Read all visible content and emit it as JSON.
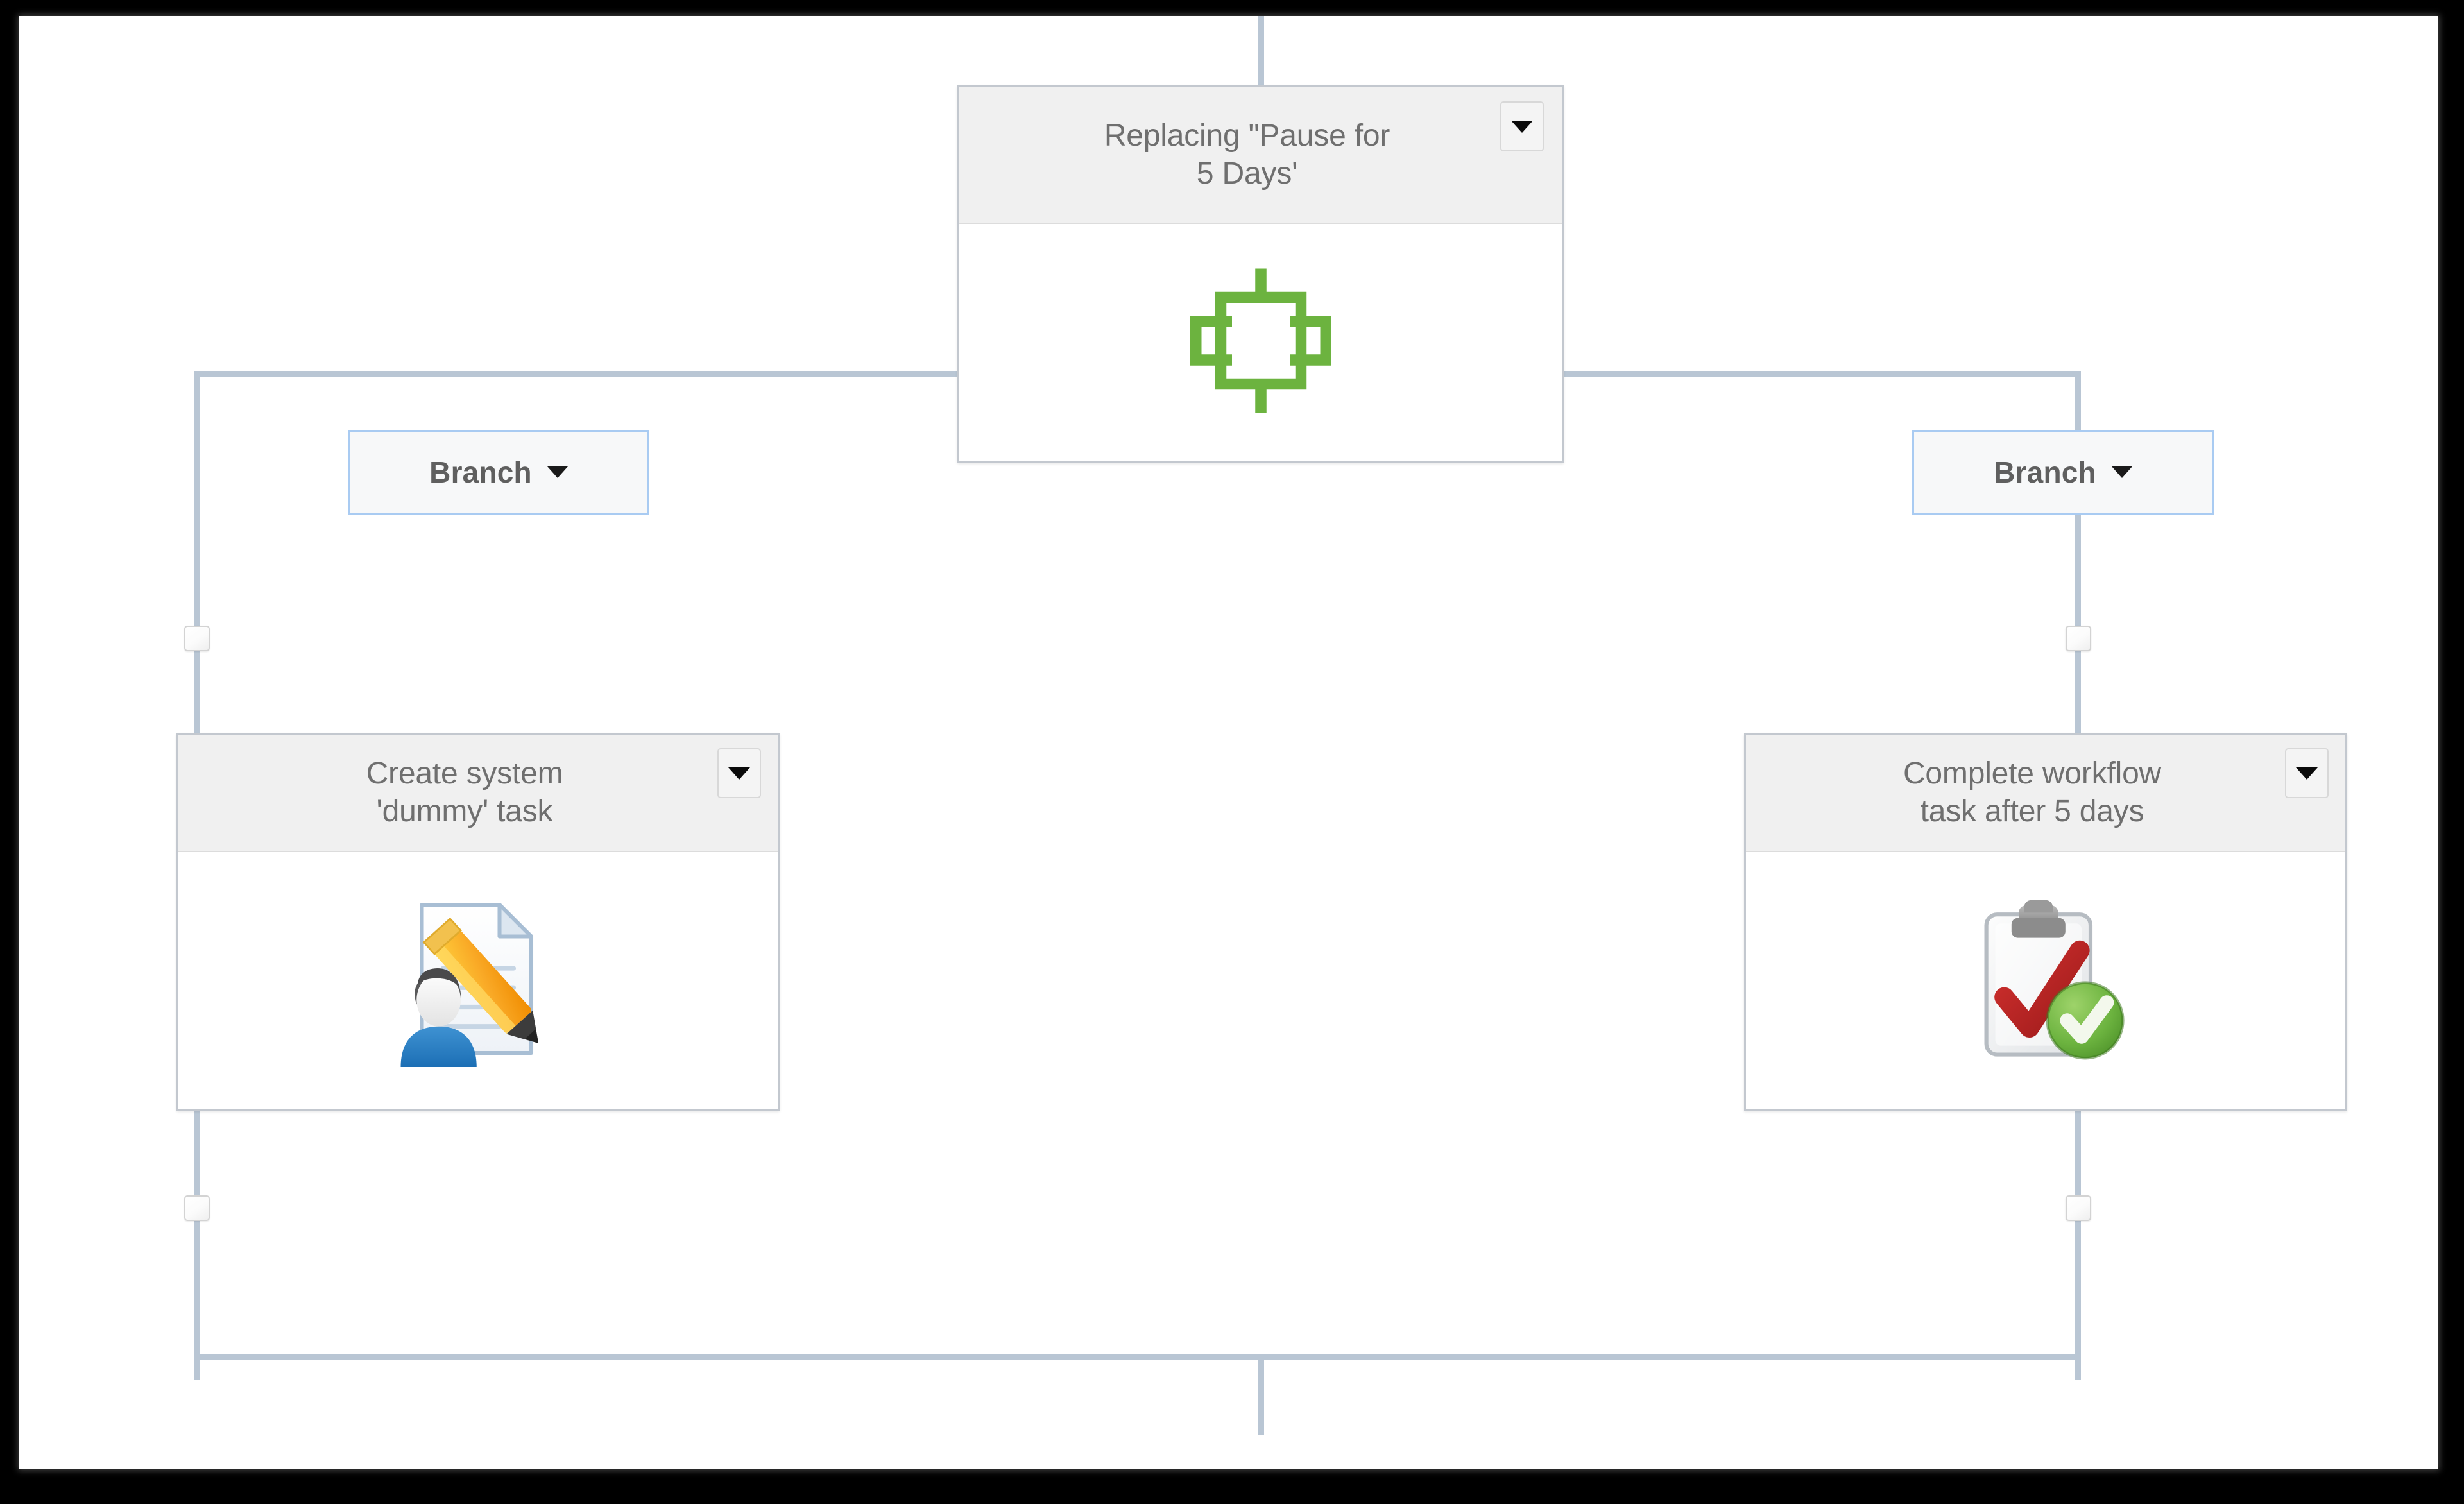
{
  "diagram": {
    "type": "workflow-designer-canvas",
    "background_color": "#ffffff",
    "frame_color": "#000000",
    "connector_color": "#b9c6d4"
  },
  "nodes": {
    "gateway": {
      "title": "Replacing \"Pause for\n5 Days'",
      "icon_name": "parallel-branch-gateway-icon",
      "icon_color": "#6cb33f",
      "menu_icon": "chevron-down-icon"
    },
    "left_task": {
      "title": "Create system\n'dummy' task",
      "icon_name": "create-user-task-icon",
      "menu_icon": "chevron-down-icon"
    },
    "right_task": {
      "title": "Complete workflow\ntask after 5 days",
      "icon_name": "complete-task-clipboard-icon",
      "menu_icon": "chevron-down-icon"
    }
  },
  "branches": {
    "left": {
      "label": "Branch",
      "caret_icon": "chevron-down-icon",
      "border_color": "#a9cbf2"
    },
    "right": {
      "label": "Branch",
      "caret_icon": "chevron-down-icon",
      "border_color": "#a9cbf2"
    }
  },
  "handles": [
    {
      "name": "left-upper-handle"
    },
    {
      "name": "left-lower-handle"
    },
    {
      "name": "right-upper-handle"
    },
    {
      "name": "right-lower-handle"
    }
  ]
}
